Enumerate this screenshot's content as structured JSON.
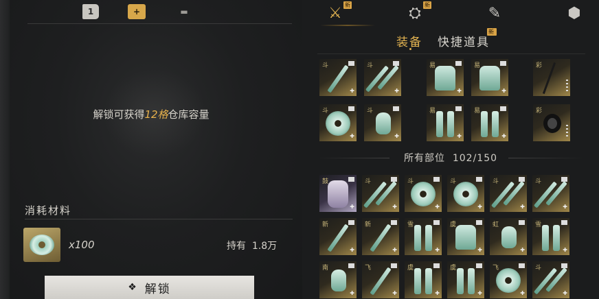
{
  "left": {
    "tabs": [
      {
        "name": "book",
        "label": "1"
      },
      {
        "name": "plus",
        "label": "+"
      },
      {
        "name": "box",
        "label": ""
      }
    ],
    "unlock_message": {
      "prefix": "解锁可获得",
      "highlight": "12格",
      "suffix": "仓库容量"
    },
    "section_title": "消耗材料",
    "material": {
      "icon": "jade-ring-icon",
      "count": "x100",
      "hold_label": "持有",
      "hold_value": "1.8万"
    },
    "unlock_button": {
      "icon": "diamond-icon",
      "label": "解锁"
    }
  },
  "right": {
    "top_tabs": [
      {
        "icon": "crossed-swords-icon",
        "glyph": "⚔",
        "new": "新",
        "active": true
      },
      {
        "icon": "bundle-icon",
        "glyph": "⛭",
        "new": "新",
        "active": false
      },
      {
        "icon": "scroll-icon",
        "glyph": "✎",
        "new": "",
        "active": false
      },
      {
        "icon": "gem-icon",
        "glyph": "⬢",
        "new": "",
        "active": false
      }
    ],
    "sub_tabs": [
      {
        "label": "装备",
        "active": true,
        "new": ""
      },
      {
        "label": "快捷道具",
        "active": false,
        "new": "新"
      }
    ],
    "equipped_rows": [
      [
        {
          "tag": "斗",
          "art": "sword"
        },
        {
          "tag": "斗",
          "art": "sword-b"
        },
        {
          "tag": "",
          "art": "empty"
        },
        {
          "tag": "易",
          "art": "armor"
        },
        {
          "tag": "易",
          "art": "armor"
        },
        {
          "tag": "",
          "art": "empty"
        },
        {
          "tag": "彩",
          "art": "stick"
        }
      ],
      [
        {
          "tag": "斗",
          "art": "disc"
        },
        {
          "tag": "斗",
          "art": "bottle"
        },
        {
          "tag": "",
          "art": "empty"
        },
        {
          "tag": "易",
          "art": "legs"
        },
        {
          "tag": "易",
          "art": "legs"
        },
        {
          "tag": "",
          "art": "empty"
        },
        {
          "tag": "彩",
          "art": "ring"
        }
      ]
    ],
    "all_slots_label": "所有部位",
    "all_slots_count": "102/150",
    "inventory": [
      {
        "tag": "鼓",
        "art": "purple"
      },
      {
        "tag": "斗",
        "art": "sword-b"
      },
      {
        "tag": "斗",
        "art": "disc"
      },
      {
        "tag": "斗",
        "art": "disc"
      },
      {
        "tag": "斗",
        "art": "sword-b"
      },
      {
        "tag": "斗",
        "art": "sword-b"
      },
      {
        "tag": "新",
        "art": "sword"
      },
      {
        "tag": "新",
        "art": "sword"
      },
      {
        "tag": "雪",
        "art": "legs"
      },
      {
        "tag": "虞",
        "art": "armor"
      },
      {
        "tag": "虹",
        "art": "bottle"
      },
      {
        "tag": "雪",
        "art": "legs"
      },
      {
        "tag": "南",
        "art": "bottle"
      },
      {
        "tag": "飞",
        "art": "sword"
      },
      {
        "tag": "虞",
        "art": "legs"
      },
      {
        "tag": "虞",
        "art": "legs"
      },
      {
        "tag": "飞",
        "art": "disc"
      },
      {
        "tag": "斗",
        "art": "sword-b"
      }
    ]
  }
}
